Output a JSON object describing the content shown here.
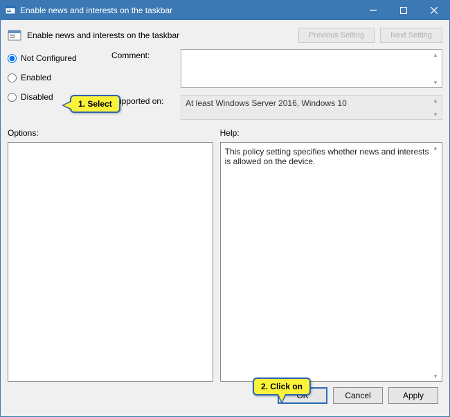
{
  "window": {
    "title": "Enable news and interests on the taskbar"
  },
  "header": {
    "policy_title": "Enable news and interests on the taskbar",
    "prev_label": "Previous Setting",
    "next_label": "Next Setting"
  },
  "radios": {
    "not_configured": "Not Configured",
    "enabled": "Enabled",
    "disabled": "Disabled"
  },
  "labels": {
    "comment": "Comment:",
    "supported_on": "Supported on:",
    "options": "Options:",
    "help": "Help:"
  },
  "fields": {
    "comment_value": "",
    "supported_value": "At least Windows Server 2016, Windows 10",
    "options_value": "",
    "help_value": "This policy setting specifies whether news and interests is allowed on the device."
  },
  "buttons": {
    "ok": "OK",
    "cancel": "Cancel",
    "apply": "Apply"
  },
  "callouts": {
    "c1": "1. Select",
    "c2": "2. Click on"
  }
}
